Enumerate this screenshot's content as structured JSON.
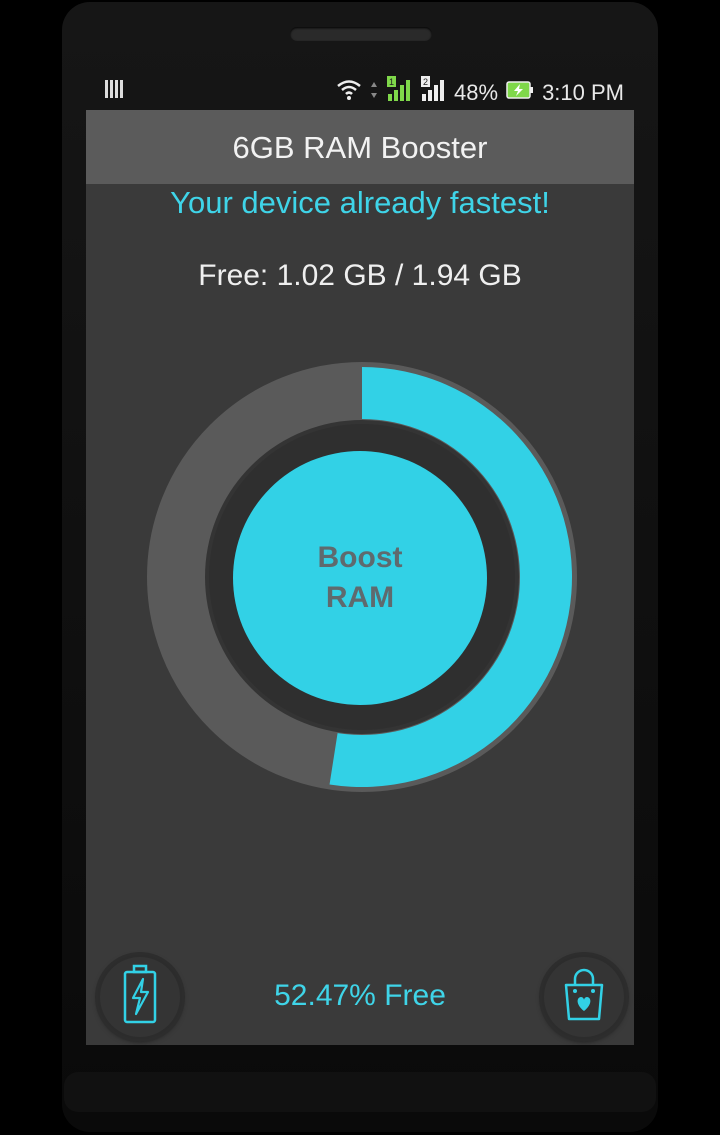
{
  "status_bar": {
    "battery_percent": "48%",
    "time": "3:10 PM",
    "icons": [
      "notification-bars-icon",
      "wifi-icon",
      "data-arrows-icon",
      "signal-sim1-icon",
      "signal-sim2-icon",
      "battery-charging-icon"
    ]
  },
  "app": {
    "title": "6GB RAM Booster",
    "message": "Your device already fastest!",
    "free_info": "Free: 1.02 GB / 1.94 GB",
    "boost_label_line1": "Boost",
    "boost_label_line2": "RAM",
    "percent_free_label": "52.47% Free",
    "percent_free_value": 52.47,
    "left_button_icon": "battery-charging-icon",
    "right_button_icon": "shopping-bag-heart-icon"
  },
  "colors": {
    "accent": "#32d1e6",
    "background": "#3a3a3a",
    "appbar": "#5b5b5b",
    "ring_track": "#5a5a5a"
  }
}
